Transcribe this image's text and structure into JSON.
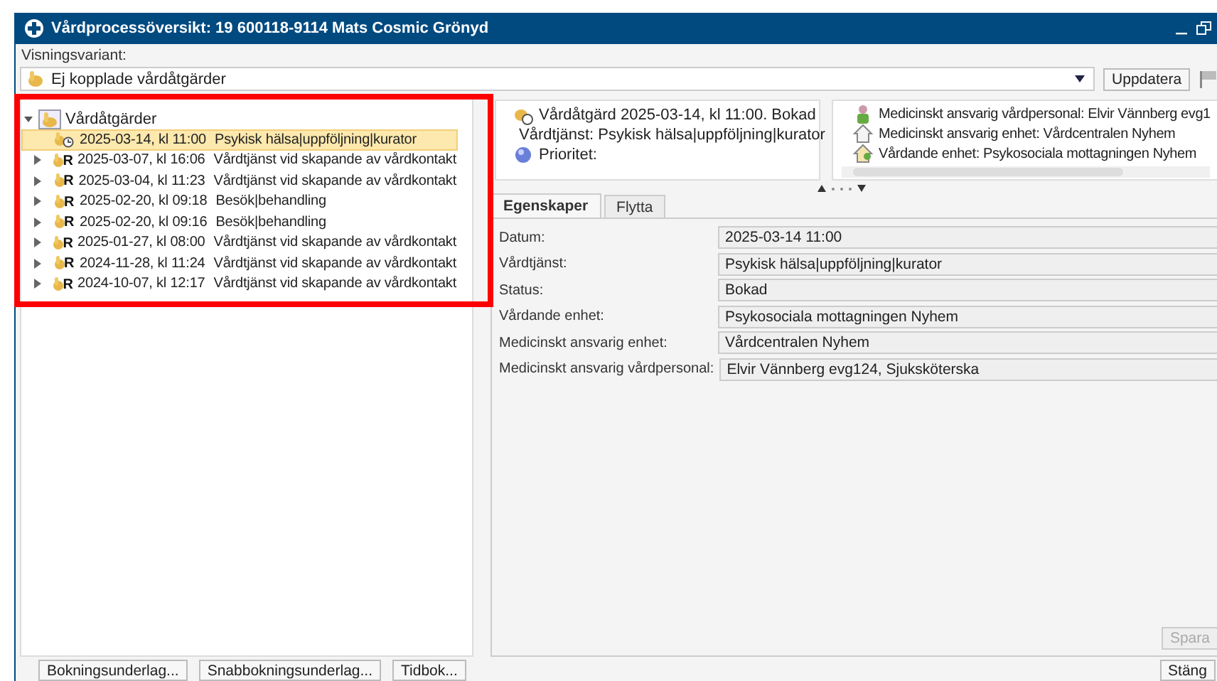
{
  "window": {
    "title": "Vårdprocessöversikt: 19 600118-9114 Mats Cosmic Grönyd"
  },
  "view_variant": {
    "label": "Visningsvariant:",
    "value": "Ej kopplade vårdåtgärder",
    "button": "Uppdatera"
  },
  "tree": {
    "root": {
      "label": "Vårdåtgärder",
      "expanded": true
    },
    "items": [
      {
        "kind": "appointment",
        "date": "2025-03-14, kl 11:00",
        "text": "Psykisk hälsa|uppföljning|kurator",
        "expandable": false,
        "selected": true
      },
      {
        "kind": "referral",
        "badge": "R",
        "date": "2025-03-07, kl 16:06",
        "text": "Vårdtjänst vid skapande av vårdkontakt",
        "expandable": true,
        "selected": false
      },
      {
        "kind": "referral",
        "badge": "R",
        "date": "2025-03-04, kl 11:23",
        "text": "Vårdtjänst vid skapande av vårdkontakt",
        "expandable": true,
        "selected": false
      },
      {
        "kind": "referral",
        "badge": "R",
        "date": "2025-02-20, kl 09:18",
        "text": "Besök|behandling",
        "expandable": true,
        "selected": false
      },
      {
        "kind": "referral",
        "badge": "R",
        "date": "2025-02-20, kl 09:16",
        "text": "Besök|behandling",
        "expandable": true,
        "selected": false
      },
      {
        "kind": "referral",
        "badge": "R",
        "date": "2025-01-27, kl 08:00",
        "text": "Vårdtjänst vid skapande av vårdkontakt",
        "expandable": true,
        "selected": false
      },
      {
        "kind": "referral",
        "badge": "R",
        "date": "2024-11-28, kl 11:24",
        "text": "Vårdtjänst vid skapande av vårdkontakt",
        "expandable": true,
        "selected": false
      },
      {
        "kind": "referral",
        "badge": "R",
        "date": "2024-10-07, kl 12:17",
        "text": "Vårdtjänst vid skapande av vårdkontakt",
        "expandable": true,
        "selected": false
      }
    ]
  },
  "summary": {
    "left": [
      {
        "kind": "procedure",
        "text": "Vårdåtgärd 2025-03-14, kl 11:00. Bokad"
      },
      {
        "kind": "service",
        "text": "Vårdtjänst: Psykisk hälsa|uppföljning|kurator"
      },
      {
        "kind": "priority",
        "text": "Prioritet:"
      }
    ],
    "right": [
      {
        "kind": "staff",
        "text": "Medicinskt ansvarig vårdpersonal: Elvir Vännberg evg1"
      },
      {
        "kind": "unit",
        "text": "Medicinskt ansvarig enhet: Vårdcentralen Nyhem"
      },
      {
        "kind": "care_unit",
        "text": "Vårdande enhet: Psykosociala mottagningen Nyhem"
      }
    ]
  },
  "tabs": [
    {
      "label": "Egenskaper",
      "selected": true
    },
    {
      "label": "Flytta",
      "selected": false
    }
  ],
  "properties": [
    {
      "label": "Datum:",
      "value": "2025-03-14 11:00"
    },
    {
      "label": "Vårdtjänst:",
      "value": "Psykisk hälsa|uppföljning|kurator"
    },
    {
      "label": "Status:",
      "value": "Bokad"
    },
    {
      "label": "Vårdande enhet:",
      "value": "Psykosociala mottagningen Nyhem"
    },
    {
      "label": "Medicinskt ansvarig enhet:",
      "value": "Vårdcentralen Nyhem"
    },
    {
      "label": "Medicinskt ansvarig vårdpersonal:",
      "value": "Elvir Vännberg evg124, Sjuksköterska"
    }
  ],
  "save_button": {
    "label": "Spara",
    "disabled": true
  },
  "footer": {
    "left_buttons": [
      "Bokningsunderlag...",
      "Snabbokningsunderlag...",
      "Tidbok..."
    ],
    "close_button": "Stäng"
  }
}
